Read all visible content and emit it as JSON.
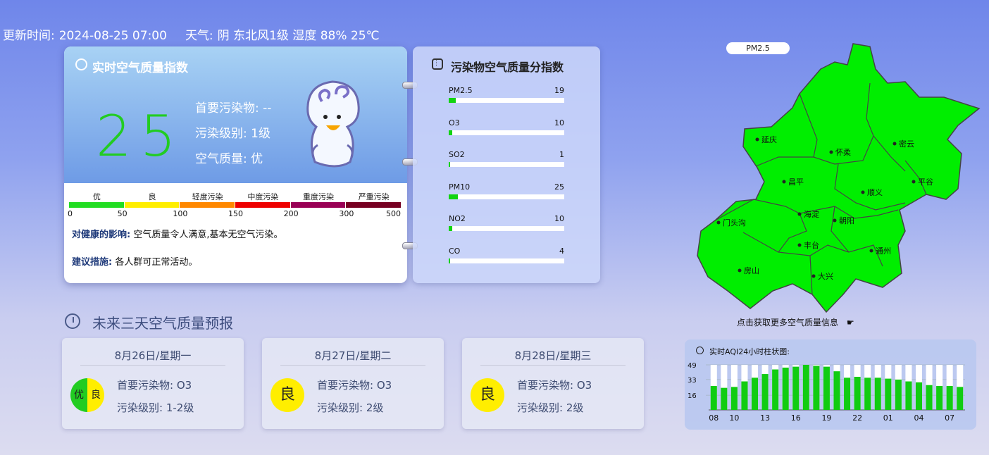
{
  "topbar": {
    "update_label": "更新时间:",
    "update_time": "2024-08-25 07:00",
    "weather_label": "天气:",
    "weather_value": "阴 东北风1级 湿度 88% 25℃"
  },
  "realtime": {
    "title": "实时空气质量指数",
    "aqi": "25",
    "primary": "首要污染物: --",
    "level": "污染级别: 1级",
    "quality": "空气质量: 优",
    "level_names": [
      "优",
      "良",
      "轻度污染",
      "中度污染",
      "重度污染",
      "严重污染"
    ],
    "level_colors": [
      "#22dd22",
      "#ffee00",
      "#ff8800",
      "#ee0000",
      "#990055",
      "#770022"
    ],
    "level_ticks": [
      "0",
      "50",
      "100",
      "150",
      "200",
      "300",
      "500"
    ],
    "health_label": "对健康的影响:",
    "health_text": "空气质量令人满意,基本无空气污染。",
    "advice_label": "建议措施:",
    "advice_text": "各人群可正常活动。"
  },
  "pollutants": {
    "title": "污染物空气质量分指数",
    "items": [
      {
        "name": "PM2.5",
        "value": "19",
        "fill": 0.06
      },
      {
        "name": "O3",
        "value": "10",
        "fill": 0.03
      },
      {
        "name": "SO2",
        "value": "1",
        "fill": 0.005
      },
      {
        "name": "PM10",
        "value": "25",
        "fill": 0.08
      },
      {
        "name": "NO2",
        "value": "10",
        "fill": 0.03
      },
      {
        "name": "CO",
        "value": "4",
        "fill": 0.012
      }
    ]
  },
  "forecast": {
    "title": "未来三天空气质量预报",
    "days": [
      {
        "date": "8月26日/星期一",
        "primary": "首要污染物: O3",
        "level": "污染级别: 1-2级",
        "badge_left": "优",
        "badge_right": "良"
      },
      {
        "date": "8月27日/星期二",
        "primary": "首要污染物: O3",
        "level": "污染级别: 2级",
        "badge": "良"
      },
      {
        "date": "8月28日/星期三",
        "primary": "首要污染物: O3",
        "level": "污染级别: 2级",
        "badge": "良"
      }
    ]
  },
  "map": {
    "tooltip": "PM2.5",
    "districts": [
      "延庆",
      "怀柔",
      "密云",
      "昌平",
      "顺义",
      "平谷",
      "门头沟",
      "海淀",
      "朝阳",
      "丰台",
      "通州",
      "房山",
      "大兴"
    ],
    "link_text": "点击获取更多空气质量信息",
    "region_color": "#00ee00"
  },
  "aqi24": {
    "title": "实时AQI24小时柱状图:"
  },
  "chart_data": {
    "type": "bar",
    "title": "实时AQI24小时柱状图:",
    "x_tick_labels": [
      "08",
      "10",
      "13",
      "16",
      "19",
      "22",
      "01",
      "04",
      "07"
    ],
    "y_tick_labels": [
      "16",
      "33",
      "49"
    ],
    "ylim": [
      0,
      49
    ],
    "values": [
      26,
      24,
      25,
      31,
      35,
      39,
      44,
      46,
      47,
      49,
      48,
      47,
      42,
      35,
      36,
      35,
      35,
      34,
      33,
      31,
      30,
      27,
      26,
      26,
      25
    ],
    "max_values": [
      49,
      49,
      49,
      49,
      49,
      49,
      49,
      49,
      49,
      49,
      49,
      49,
      49,
      49,
      49,
      49,
      49,
      49,
      49,
      49,
      49,
      49,
      49,
      49,
      49
    ],
    "colors": {
      "value": "#11cc11",
      "remainder": "#ffffff"
    }
  }
}
